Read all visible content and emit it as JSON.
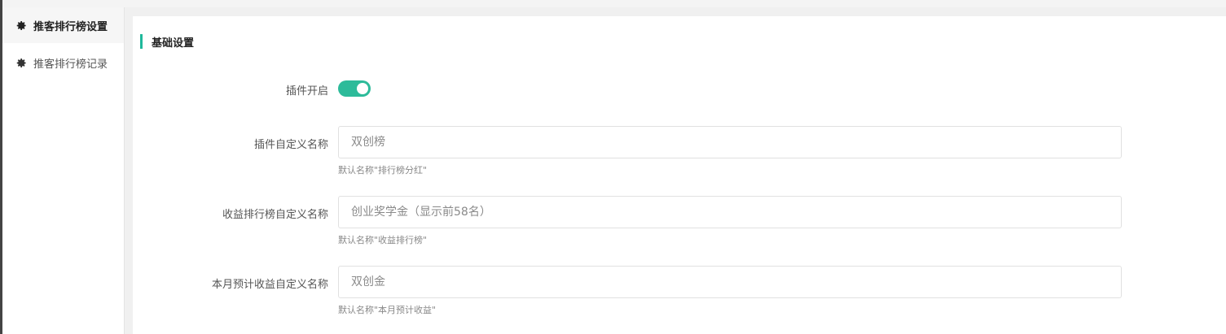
{
  "sidebar": {
    "items": [
      {
        "label": "推客排行榜设置",
        "icon": "gear-icon",
        "active": true
      },
      {
        "label": "推客排行榜记录",
        "icon": "gear-icon",
        "active": false
      }
    ]
  },
  "section": {
    "title": "基础设置"
  },
  "form": {
    "plugin_enabled": {
      "label": "插件开启",
      "value": true
    },
    "plugin_name": {
      "label": "插件自定义名称",
      "placeholder": "双创榜",
      "help": "默认名称\"排行榜分红\""
    },
    "income_rank_name": {
      "label": "收益排行榜自定义名称",
      "placeholder": "创业奖学金（显示前58名）",
      "help": "默认名称\"收益排行榜\""
    },
    "monthly_estimate_name": {
      "label": "本月预计收益自定义名称",
      "placeholder": "双创金",
      "help": "默认名称\"本月预计收益\""
    }
  },
  "colors": {
    "accent": "#1fb89b",
    "toggle_on": "#2dbb9a"
  }
}
